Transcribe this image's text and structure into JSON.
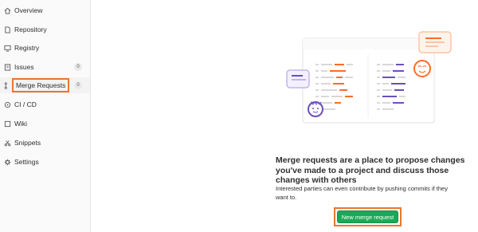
{
  "sidebar": {
    "items": [
      {
        "label": "Overview",
        "icon": "home-icon"
      },
      {
        "label": "Repository",
        "icon": "doc-icon"
      },
      {
        "label": "Registry",
        "icon": "monitor-icon"
      },
      {
        "label": "Issues",
        "icon": "issues-icon",
        "badge": "0"
      },
      {
        "label": "Merge Requests",
        "icon": "merge-request-icon",
        "badge": "0",
        "active": true
      },
      {
        "label": "CI / CD",
        "icon": "rocket-icon"
      },
      {
        "label": "Wiki",
        "icon": "book-icon"
      },
      {
        "label": "Snippets",
        "icon": "scissors-icon"
      },
      {
        "label": "Settings",
        "icon": "gear-icon"
      }
    ]
  },
  "empty_state": {
    "title": "Merge requests are a place to propose changes you've made to a project and discuss those changes with others",
    "description": "Interested parties can even contribute by pushing commits if they want to.",
    "button_label": "New merge request"
  },
  "colors": {
    "accent_orange": "#e8772e",
    "button_green": "#1aaa55",
    "illustration_purple": "#6b4fbb",
    "illustration_orange": "#fc6d26"
  }
}
